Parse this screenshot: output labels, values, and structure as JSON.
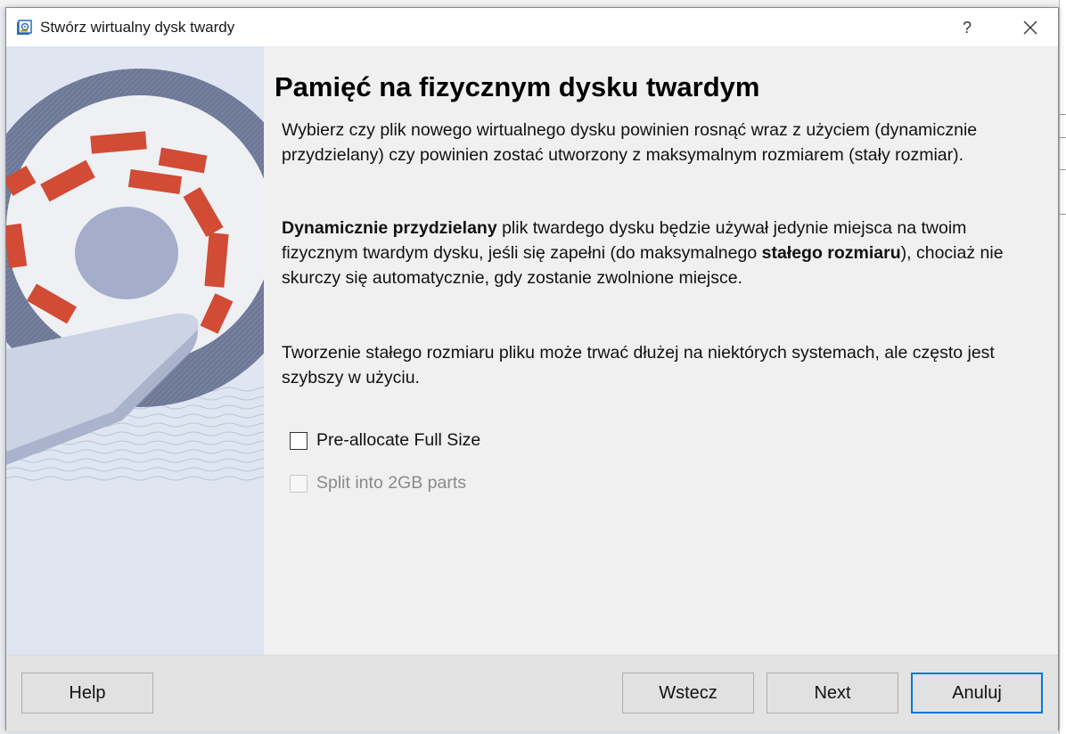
{
  "dialog": {
    "title": "Stwórz wirtualny dysk twardy",
    "help_glyph": "?",
    "close_glyph": "✕"
  },
  "page": {
    "heading": "Pamięć na fizycznym dysku twardym",
    "p1": "Wybierz czy plik nowego wirtualnego dysku powinien rosnąć wraz z użyciem (dynamicznie przydzielany) czy powinien zostać utworzony z maksymalnym rozmiarem (stały rozmiar).",
    "p2_bold1": "Dynamicznie przydzielany",
    "p2_text1": " plik twardego dysku będzie używał jedynie miejsca na twoim fizycznym twardym dysku, jeśli się zapełni (do maksymalnego ",
    "p2_bold2": "stałego rozmiaru",
    "p2_text2": "), chociaż nie skurczy się automatycznie, gdy zostanie zwolnione miejsce.",
    "p3": "Tworzenie stałego rozmiaru pliku może trwać dłużej na niektórych systemach, ale często jest szybszy w użyciu."
  },
  "options": {
    "preallocate": {
      "label": "Pre-allocate Full Size",
      "checked": false,
      "enabled": true
    },
    "split": {
      "label": "Split into 2GB parts",
      "checked": false,
      "enabled": false
    }
  },
  "buttons": {
    "help": "Help",
    "back": "Wstecz",
    "next": "Next",
    "cancel": "Anuluj"
  },
  "colors": {
    "disk_red": "#d14b35",
    "disk_gray": "#6d7897",
    "default_button_border": "#0078d7"
  },
  "icons": {
    "app": "virtualbox-disk-icon",
    "side": "hard-disk-illustration"
  }
}
